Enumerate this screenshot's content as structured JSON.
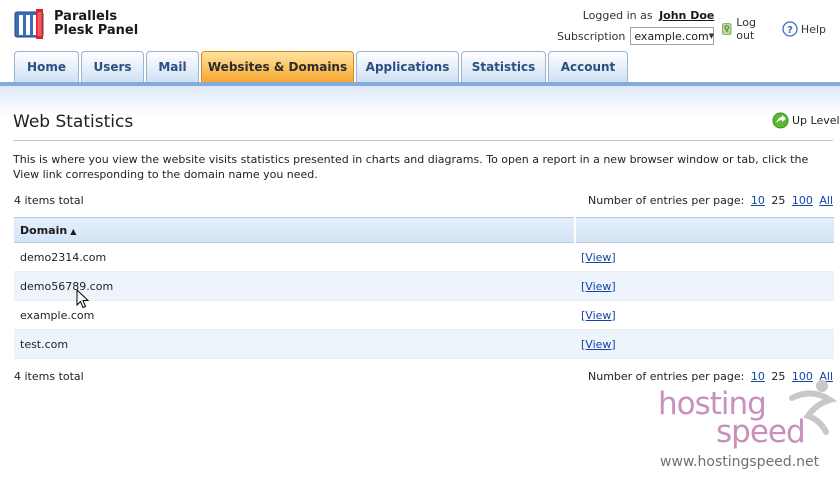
{
  "header": {
    "logo_line1": "Parallels",
    "logo_line2": "Plesk Panel",
    "logged_in_label": "Logged in as",
    "user_name": "John Doe",
    "subscription_label": "Subscription",
    "subscription_value": "example.com",
    "logout_label": "Log out",
    "help_label": "Help"
  },
  "tabs": [
    {
      "label": "Home",
      "active": false
    },
    {
      "label": "Users",
      "active": false
    },
    {
      "label": "Mail",
      "active": false
    },
    {
      "label": "Websites & Domains",
      "active": true
    },
    {
      "label": "Applications",
      "active": false
    },
    {
      "label": "Statistics",
      "active": false
    },
    {
      "label": "Account",
      "active": false
    }
  ],
  "page": {
    "title": "Web Statistics",
    "up_level_label": "Up Level",
    "description": "This is where you view the website visits statistics presented in charts and diagrams. To open a report in a new browser window or tab, click the View link corresponding to the domain name you need.",
    "items_total": "4 items total",
    "entries_per_page_label": "Number of entries per page:",
    "page_sizes": [
      "10",
      "25",
      "100",
      "All"
    ],
    "current_page_size": "25"
  },
  "table": {
    "columns": [
      "Domain",
      ""
    ],
    "sort_indicator": "▲",
    "rows": [
      {
        "domain": "demo2314.com",
        "action": "[View]"
      },
      {
        "domain": "demo56789.com",
        "action": "[View]"
      },
      {
        "domain": "example.com",
        "action": "[View]"
      },
      {
        "domain": "test.com",
        "action": "[View]"
      }
    ]
  },
  "watermark": {
    "word1": "hosting",
    "word2": "speed",
    "url": "www.hostingspeed.net"
  },
  "colors": {
    "tab_active": "#f6a62e",
    "tab_inactive": "#cfe0f4",
    "tab_bar": "#84abda",
    "link": "#1545a3",
    "watermark": "#c98fbd"
  }
}
